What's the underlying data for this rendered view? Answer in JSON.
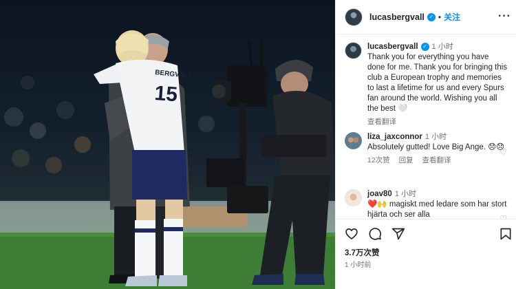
{
  "post": {
    "username": "lucasbergvall",
    "follow_label": "关注",
    "more_label": "···",
    "separator": "•",
    "verified_mark": "✓",
    "jersey_name": "BERGVALL",
    "jersey_number": "15"
  },
  "caption": {
    "username": "lucasbergvall",
    "time": "1 小时",
    "text": "Thank you for everything you have done for me. Thank you for bringing this club a European trophy and memories to last a lifetime for us and every Spurs fan around the world. Wishing you all the best 🤍",
    "translate_label": "查看翻译"
  },
  "comments": [
    {
      "username": "liza_jaxconnor",
      "time": "1 小时",
      "text": "Absolutely gutted! Love Big Ange. 😞😞",
      "likes_label": "12次赞",
      "reply_label": "回复",
      "translate_label": "查看翻译"
    },
    {
      "username": "joav80",
      "time": "1 小时",
      "text": "❤️🙌 magiskt med ledare som har stort hjärta och ser alla"
    }
  ],
  "footer": {
    "likes": "3.7万次赞",
    "posted_time": "1 小时前"
  },
  "icons": {
    "heart": "heart-icon",
    "comment": "comment-icon",
    "share": "share-icon",
    "save": "bookmark-icon"
  },
  "colors": {
    "accent": "#0095f6",
    "text": "#262626",
    "secondary": "#737373"
  }
}
